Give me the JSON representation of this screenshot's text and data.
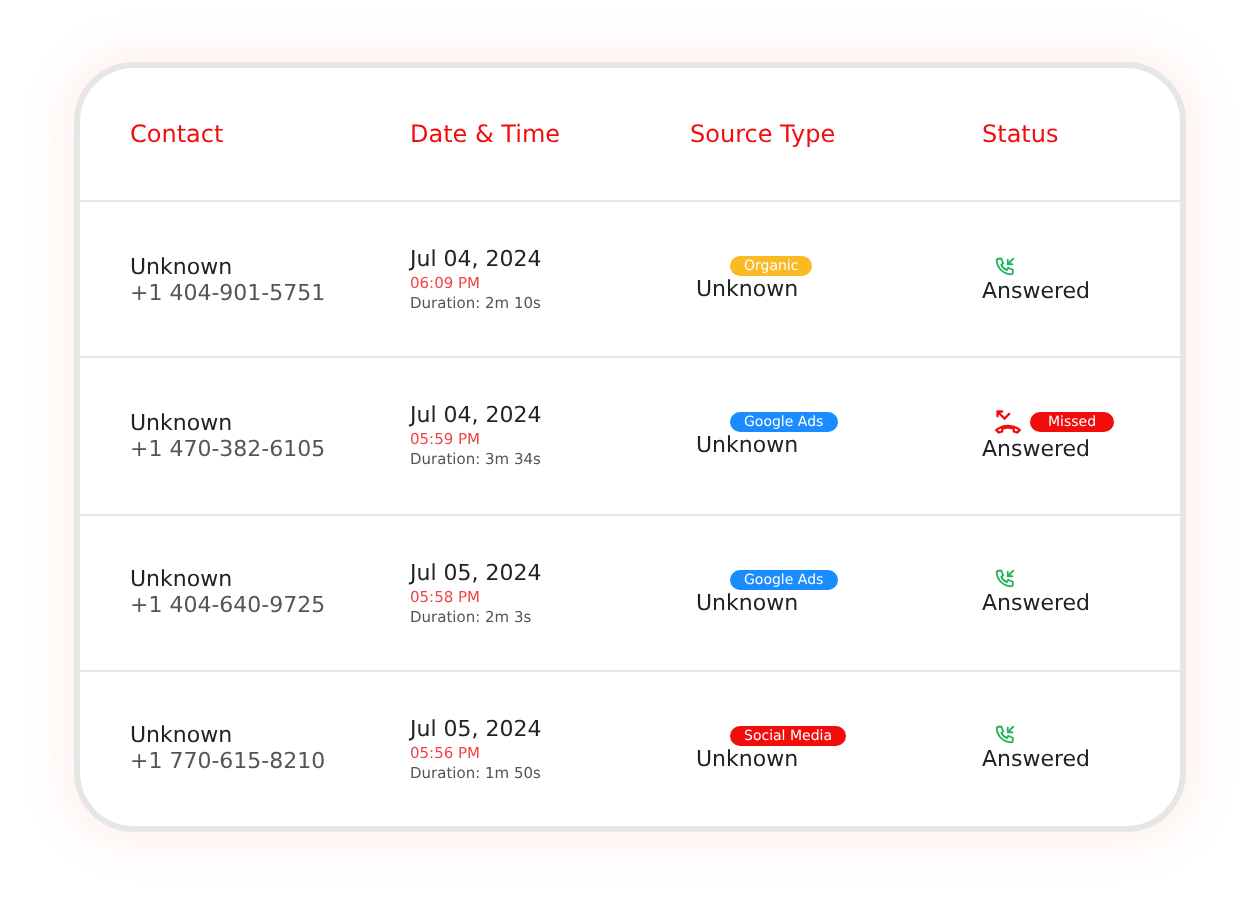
{
  "columns": [
    "Contact",
    "Date & Time",
    "Source Type",
    "Status"
  ],
  "rows": [
    {
      "name": "Unknown",
      "phone": "+1 404-901-5751",
      "date": "Jul 04, 2024",
      "time": "06:09 PM",
      "duration": "Duration: 2m 10s",
      "tag": {
        "label": "Organic",
        "color": "#fbb924"
      },
      "source": "Unknown",
      "call": {
        "kind": "answered"
      },
      "status": "Answered"
    },
    {
      "name": "Unknown",
      "phone": "+1 470-382-6105",
      "date": "Jul 04, 2024",
      "time": "05:59 PM",
      "duration": "Duration: 3m 34s",
      "tag": {
        "label": "Google Ads",
        "color": "#1a8cff"
      },
      "source": "Unknown",
      "call": {
        "kind": "missed",
        "badge": "Missed"
      },
      "status": "Answered"
    },
    {
      "name": "Unknown",
      "phone": "+1 404-640-9725",
      "date": "Jul 05, 2024",
      "time": "05:58 PM",
      "duration": "Duration: 2m 3s",
      "tag": {
        "label": "Google Ads",
        "color": "#1a8cff"
      },
      "source": "Unknown",
      "call": {
        "kind": "answered"
      },
      "status": "Answered"
    },
    {
      "name": "Unknown",
      "phone": "+1 770-615-8210",
      "date": "Jul 05, 2024",
      "time": "05:56 PM",
      "duration": "Duration: 1m 50s",
      "tag": {
        "label": "Social Media",
        "color": "#f20d0d"
      },
      "source": "Unknown",
      "call": {
        "kind": "answered"
      },
      "status": "Answered"
    }
  ]
}
